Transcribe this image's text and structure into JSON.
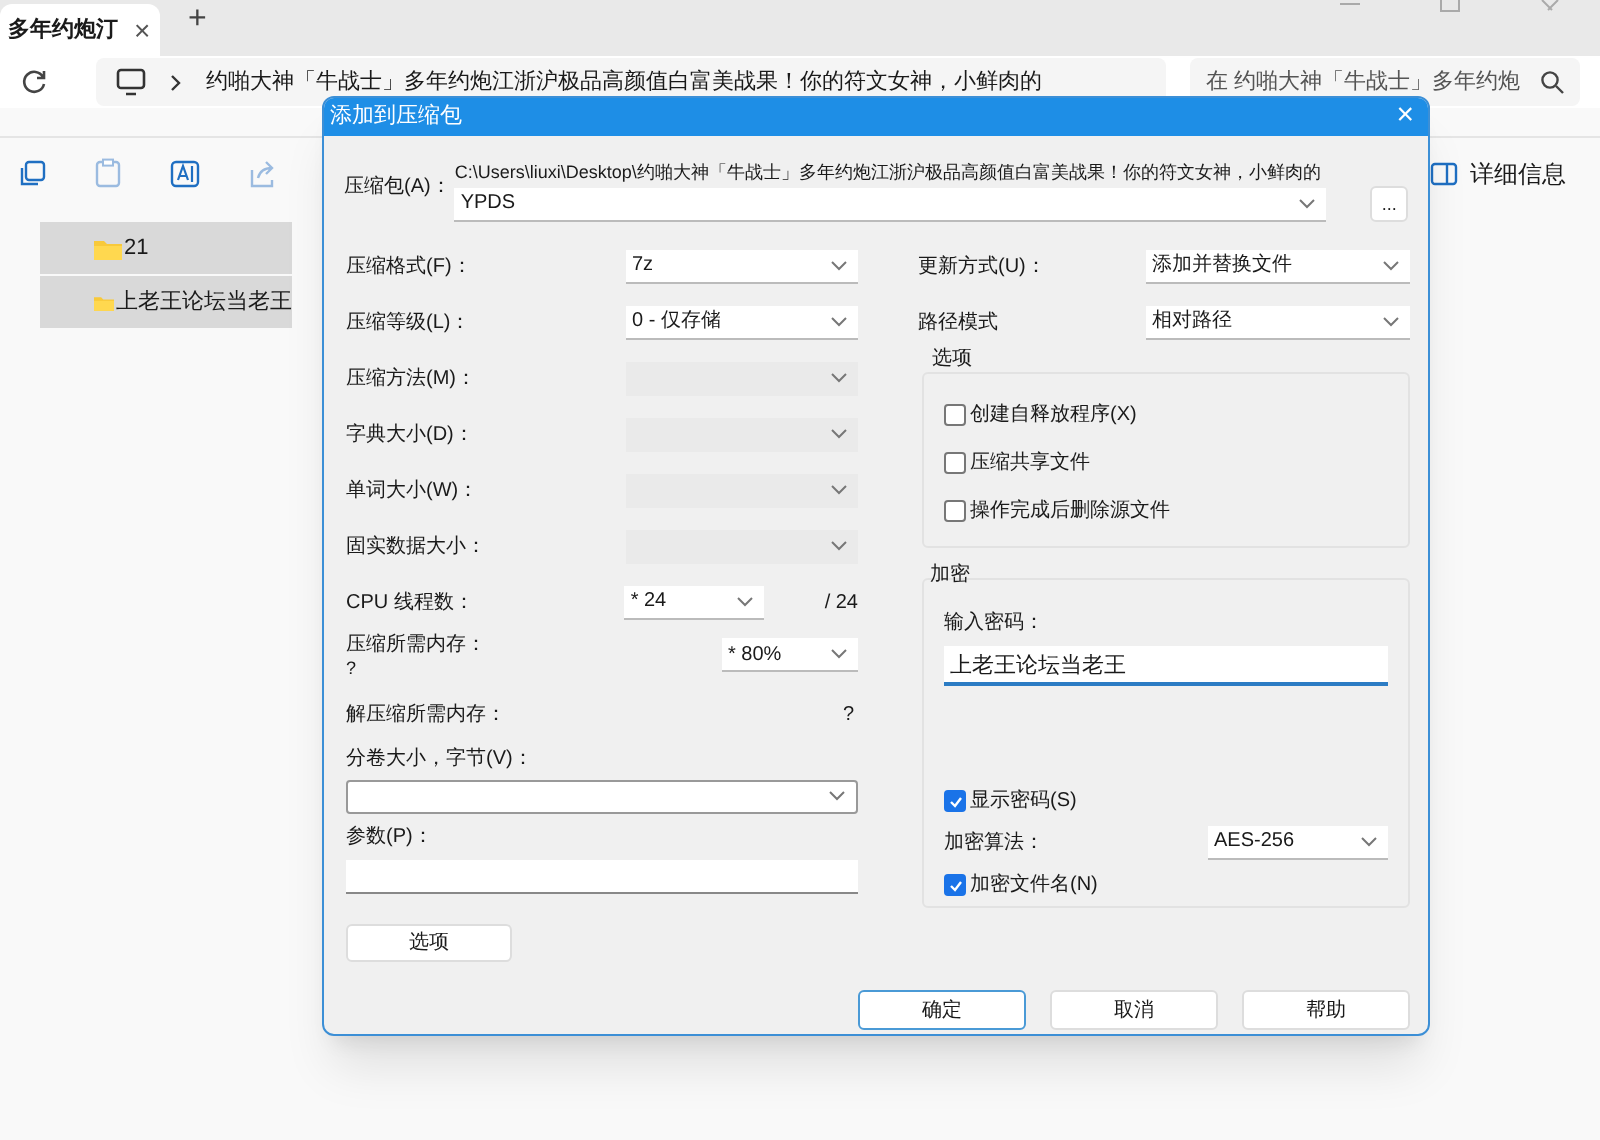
{
  "explorer": {
    "tab": {
      "title": "多年约炮汀",
      "close": "×"
    },
    "new_tab": "+",
    "address": "约啪大神「牛战士」多年约炮江浙沪极品高颜值白富美战果！你的符文女神，小鲜肉的",
    "search": {
      "placeholder": "在 约啪大神「牛战士」多年约炮"
    },
    "details": "详细信息",
    "files": [
      {
        "name": "21"
      },
      {
        "name": "上老王论坛当老王"
      }
    ]
  },
  "dialog": {
    "title": "添加到压缩包",
    "close": "×",
    "archive": {
      "label": "压缩包(A)：",
      "path": "C:\\Users\\liuxi\\Desktop\\约啪大神「牛战士」多年约炮江浙沪极品高颜值白富美战果！你的符文女神，小鲜肉的",
      "value": "YPDS",
      "browse": "..."
    },
    "left_rows": [
      {
        "kind": "select",
        "label": "压缩格式(F)：",
        "value": "7z",
        "disabled": false
      },
      {
        "kind": "select",
        "label": "压缩等级(L)：",
        "value": "0 - 仅存储",
        "disabled": false
      },
      {
        "kind": "select",
        "label": "压缩方法(M)：",
        "disabled": true
      },
      {
        "kind": "select",
        "label": "字典大小(D)：",
        "disabled": true
      },
      {
        "kind": "select",
        "label": "单词大小(W)：",
        "disabled": true
      },
      {
        "kind": "select",
        "label": "固实数据大小：",
        "disabled": true
      },
      {
        "kind": "cpu",
        "label": "CPU 线程数：",
        "value": "* 24",
        "suffix": "/ 24"
      },
      {
        "kind": "memory",
        "label": "压缩所需内存：",
        "note": "?",
        "value": "* 80%"
      },
      {
        "kind": "info",
        "label": "解压缩所需内存：",
        "value": "?"
      },
      {
        "kind": "wide_select",
        "label": "分卷大小，字节(V)："
      },
      {
        "kind": "text_field",
        "label": "参数(P)："
      }
    ],
    "options_button": "选项",
    "update_mode": {
      "label": "更新方式(U)：",
      "value": "添加并替换文件"
    },
    "path_mode": {
      "label": "路径模式",
      "value": "相对路径"
    },
    "options": {
      "title": "选项",
      "items": [
        {
          "label": "创建自释放程序(X)",
          "checked": false
        },
        {
          "label": "压缩共享文件",
          "checked": false
        },
        {
          "label": "操作完成后删除源文件",
          "checked": false
        }
      ]
    },
    "encryption": {
      "title": "加密",
      "password_label": "输入密码：",
      "password": "上老王论坛当老王",
      "show_password": {
        "label": "显示密码(S)",
        "checked": true
      },
      "method": {
        "label": "加密算法：",
        "value": "AES-256"
      },
      "encrypt_names": {
        "label": "加密文件名(N)",
        "checked": true
      }
    },
    "buttons": [
      {
        "label": "确定",
        "focused": true
      },
      {
        "label": "取消",
        "focused": false
      },
      {
        "label": "帮助",
        "focused": false
      }
    ]
  }
}
